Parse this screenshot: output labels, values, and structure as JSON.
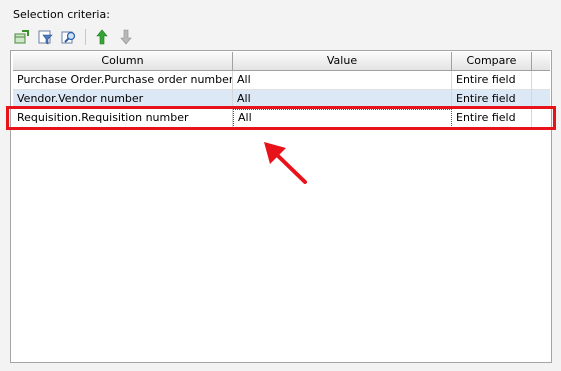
{
  "section": {
    "label": "Selection criteria:"
  },
  "toolbar": {
    "buttons": [
      {
        "icon": "add-row-icon"
      },
      {
        "icon": "filter-icon"
      },
      {
        "icon": "search-icon"
      },
      {
        "icon": "move-up-icon"
      },
      {
        "icon": "move-down-icon"
      }
    ]
  },
  "grid": {
    "headers": {
      "column": "Column",
      "value": "Value",
      "compare": "Compare"
    },
    "rows": [
      {
        "column": "Purchase Order.Purchase order number",
        "value": "All",
        "compare": "Entire field"
      },
      {
        "column": "Vendor.Vendor number",
        "value": "All",
        "compare": "Entire field"
      },
      {
        "column": "Requisition.Requisition number",
        "value": "All",
        "compare": "Entire field"
      }
    ]
  },
  "colors": {
    "highlight": "#e8121a",
    "selected_row": "#dde8f6",
    "up_arrow": "#2e9a2e"
  }
}
